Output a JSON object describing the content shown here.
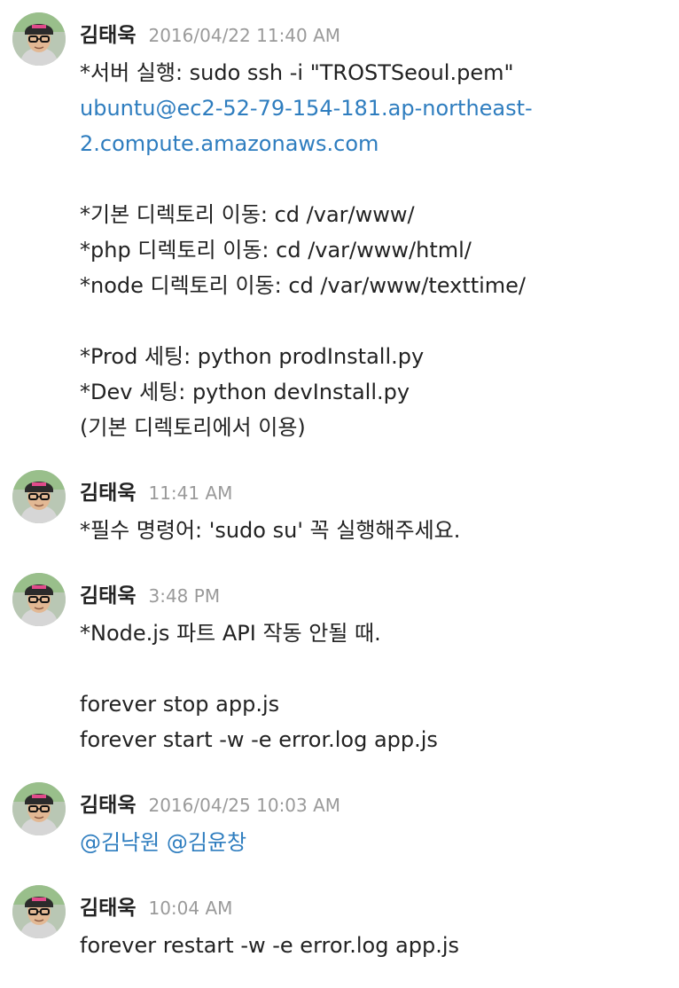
{
  "messages": [
    {
      "sender": "김태욱",
      "time": "2016/04/22 11:40 AM",
      "lines": [
        "*서버 실행: sudo ssh -i \"TROSTSeoul.pem\"",
        "ubuntu@ec2-52-79-154-181.ap-northeast-",
        "2.compute.amazonaws.com",
        "*기본 디렉토리 이동: cd /var/www/",
        "*php 디렉토리 이동: cd /var/www/html/",
        "*node 디렉토리 이동: cd /var/www/texttime/",
        "*Prod 세팅: python prodInstall.py",
        "*Dev 세팅: python devInstall.py",
        "(기본 디렉토리에서 이용)"
      ]
    },
    {
      "sender": "김태욱",
      "time": "11:41 AM",
      "lines": [
        "*필수 명령어: 'sudo su' 꼭 실행해주세요."
      ]
    },
    {
      "sender": "김태욱",
      "time": "3:48 PM",
      "lines": [
        "*Node.js 파트 API 작동 안될 때.",
        "forever stop app.js",
        "forever start -w -e error.log app.js"
      ]
    },
    {
      "sender": "김태욱",
      "time": "2016/04/25 10:03 AM",
      "mentions": [
        "@김낙원",
        "@김윤창"
      ]
    },
    {
      "sender": "김태욱",
      "time": "10:04 AM",
      "lines": [
        "forever restart -w -e error.log app.js"
      ]
    }
  ],
  "colors": {
    "link": "#2e7dbf",
    "timestamp": "#9a9a9a",
    "text": "#222222"
  }
}
